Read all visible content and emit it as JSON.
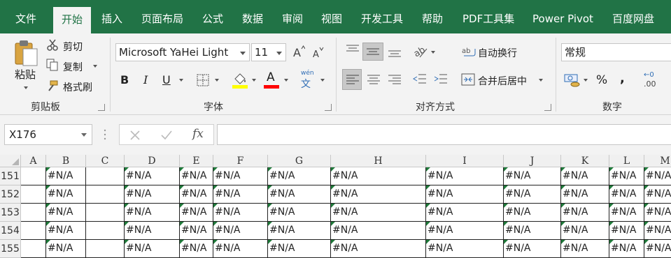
{
  "tabs": [
    {
      "label": "文件",
      "active": false
    },
    {
      "label": "开始",
      "active": true
    },
    {
      "label": "插入",
      "active": false
    },
    {
      "label": "页面布局",
      "active": false
    },
    {
      "label": "公式",
      "active": false
    },
    {
      "label": "数据",
      "active": false
    },
    {
      "label": "审阅",
      "active": false
    },
    {
      "label": "视图",
      "active": false
    },
    {
      "label": "开发工具",
      "active": false
    },
    {
      "label": "帮助",
      "active": false
    },
    {
      "label": "PDF工具集",
      "active": false
    },
    {
      "label": "Power Pivot",
      "active": false
    },
    {
      "label": "百度网盘",
      "active": false
    }
  ],
  "clipboard": {
    "paste": "粘贴",
    "cut": "剪切",
    "copy": "复制",
    "format_painter": "格式刷",
    "group_label": "剪贴板"
  },
  "font": {
    "name": "Microsoft YaHei Light",
    "size": "11",
    "group_label": "字体",
    "bold": "B",
    "italic": "I",
    "underline": "U",
    "font_color_glyph": "A",
    "phonetic_top": "wén",
    "phonetic_bottom": "文",
    "fill_color": "#FFFF00",
    "font_color": "#FF0000"
  },
  "alignment": {
    "wrap_text": "自动换行",
    "merge_center": "合并后居中",
    "group_label": "对齐方式"
  },
  "number": {
    "format": "常规",
    "percent": "%",
    "comma": ",",
    "group_label": "数字",
    "inc_decimal_top": "←0",
    "inc_decimal_bottom": ".00"
  },
  "formula_bar": {
    "name_box": "X176",
    "fx": "fx",
    "value": ""
  },
  "sheet": {
    "columns": [
      "A",
      "B",
      "C",
      "D",
      "E",
      "F",
      "G",
      "H",
      "I",
      "J",
      "K",
      "L",
      "M"
    ],
    "rows": [
      {
        "num": "151",
        "cells": [
          "",
          "#N/A",
          "",
          "#N/A",
          "#N/A",
          "#N/A",
          "#N/A",
          "#N/A",
          "#N/A",
          "#N/A",
          "#N/A",
          "#N/A",
          "#N/A"
        ]
      },
      {
        "num": "152",
        "cells": [
          "",
          "#N/A",
          "",
          "#N/A",
          "#N/A",
          "#N/A",
          "#N/A",
          "#N/A",
          "#N/A",
          "#N/A",
          "#N/A",
          "#N/A",
          "#N/A"
        ]
      },
      {
        "num": "153",
        "cells": [
          "",
          "#N/A",
          "",
          "#N/A",
          "#N/A",
          "#N/A",
          "#N/A",
          "#N/A",
          "#N/A",
          "#N/A",
          "#N/A",
          "#N/A",
          "#N/A"
        ]
      },
      {
        "num": "154",
        "cells": [
          "",
          "#N/A",
          "",
          "#N/A",
          "#N/A",
          "#N/A",
          "#N/A",
          "#N/A",
          "#N/A",
          "#N/A",
          "#N/A",
          "#N/A",
          "#N/A"
        ]
      },
      {
        "num": "155",
        "cells": [
          "",
          "#N/A",
          "",
          "#N/A",
          "#N/A",
          "#N/A",
          "#N/A",
          "#N/A",
          "#N/A",
          "#N/A",
          "#N/A",
          "#N/A",
          "#N/A"
        ]
      }
    ],
    "error_indicator_color": "#1F7A3A"
  },
  "colors": {
    "ribbon_accent": "#217346",
    "ribbon_bg": "#F3F3F3"
  }
}
